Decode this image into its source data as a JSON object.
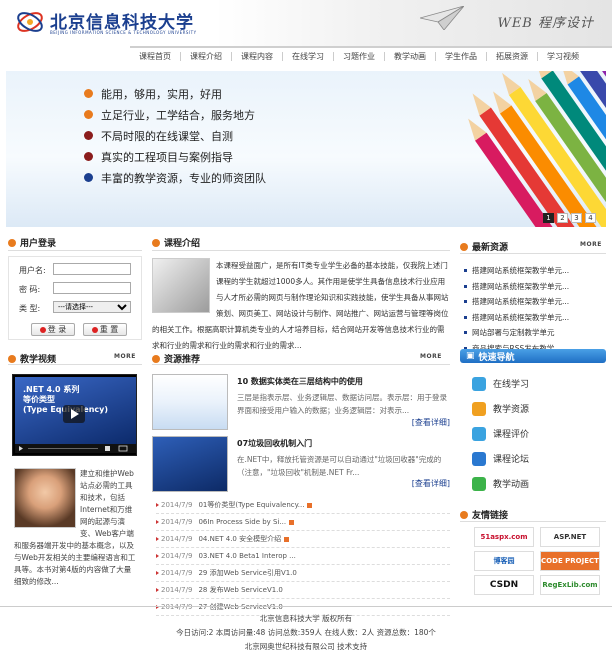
{
  "header": {
    "logo_cn": "北京信息科技大学",
    "logo_en": "BEIJING INFORMATION SCIENCE & TECHNOLOGY UNIVERSITY",
    "slogan": "WEB 程序设计"
  },
  "nav": [
    "课程首页",
    "课程介绍",
    "课程内容",
    "在线学习",
    "习题作业",
    "教学动画",
    "学生作品",
    "拓展资源",
    "学习视频"
  ],
  "banner": {
    "features": [
      {
        "text": "能用，够用，实用，好用",
        "color": "#e87b1e"
      },
      {
        "text": "立足行业，工学结合，服务地方",
        "color": "#e87b1e"
      },
      {
        "text": "不局时限的在线课堂、自测",
        "color": "#8b1d1d"
      },
      {
        "text": "真实的工程项目与案例指导",
        "color": "#8b1d1d"
      },
      {
        "text": "丰富的教学资源，专业的师资团队",
        "color": "#1b3f8f"
      }
    ],
    "pager": [
      "1",
      "2",
      "3",
      "4"
    ],
    "active_page": "1"
  },
  "login": {
    "title": "用户登录",
    "username_label": "用户名:",
    "password_label": "密  码:",
    "type_label": "类  型:",
    "type_selected": "---请选择---",
    "login_btn": "登 录",
    "reset_btn": "重 置"
  },
  "intro": {
    "title": "课程介绍",
    "text": "本课程受益面广，是所有IT类专业学生必备的基本技能，仅我院上述门课程的学生就超过1000多人。其作用是使学生具备信息技术行业应用与人才所必需的网页与制作理论知识和实践技能，使学生具备从事网站策划、网页美工、网站设计与制作、网站推广、网站运营与管理等岗位的相关工作。根据高职计算机类专业的人才培养目标，结合网站开发等信息技术行业的需求和行业的需求和行业的需求和行业的需求..."
  },
  "video": {
    "title": "教学视频",
    "more": "MORE",
    "screen_title": ".NET 4.0 系列\n等价类型\n(Type Equivalency)",
    "desc": "建立和维护Web站点必需的工具和技术，包括Internet和万维网的起源与演变、Web客户端和服务器端开发中的基本概念，以及与Web开发相关的主要编程语言和工具等。本书对第4版的内容做了大量细致的修改..."
  },
  "resources": {
    "title": "资源推荐",
    "more": "MORE",
    "items": [
      {
        "title": "10  数据实体类在三层结构中的使用",
        "desc": "三层是指表示层、业务逻辑层、数据访问层。表示层：用于登录界面和接受用户输入的数据；业务逻辑层：对表示...",
        "more": "[查看详细]"
      },
      {
        "title": "07垃圾回收机制入门",
        "desc": "在.NET中，释放托管资源是可以自动通过\"垃圾回收器\"完成的（注意，\"垃圾回收\"机制是.NET Fr...",
        "more": "[查看详细]"
      }
    ],
    "news": [
      {
        "date": "2014/7/9",
        "title": "01等价类型(Type Equivalency...",
        "new": true
      },
      {
        "date": "2014/7/9",
        "title": "06In Process Side by Si...",
        "new": true
      },
      {
        "date": "2014/7/9",
        "title": "04.NET 4.0 安全模型介绍",
        "new": true
      },
      {
        "date": "2014/7/9",
        "title": "03.NET 4.0 Beta1 Interop ...",
        "new": false
      },
      {
        "date": "2014/7/9",
        "title": "29 添加Web Service引用V1.0",
        "new": false
      },
      {
        "date": "2014/7/9",
        "title": "28 发布Web ServiceV1.0",
        "new": false
      },
      {
        "date": "2014/7/9",
        "title": "27 创建Web ServiceV1.0",
        "new": false
      }
    ]
  },
  "latest": {
    "title": "最新资源",
    "more": "MORE",
    "items": [
      "搭建网站系统框架教学单元...",
      "搭建网站系统框架教学单元...",
      "搭建网站系统框架教学单元...",
      "搭建网站系统框架教学单元...",
      "网站部署与定制教学单元",
      "商品搜索与RSS发布教学..."
    ]
  },
  "quick_nav": {
    "title": "快速导航",
    "items": [
      {
        "label": "在线学习",
        "color": "#3aa3e0"
      },
      {
        "label": "教学资源",
        "color": "#f0a020"
      },
      {
        "label": "课程评价",
        "color": "#3aa3e0"
      },
      {
        "label": "课程论坛",
        "color": "#2a78d0"
      },
      {
        "label": "教学动画",
        "color": "#3cb34a"
      }
    ]
  },
  "friend_links": {
    "title": "友情链接",
    "items": [
      {
        "label": "51aspx.com",
        "color": "#c8102e"
      },
      {
        "label": "ASP.NET",
        "color": "#333333"
      },
      {
        "label": "博客园",
        "color": "#1e63b8"
      },
      {
        "label": "CODE PROJECT",
        "color": "#e8702a"
      },
      {
        "label": "CSDN",
        "color": "#111111"
      },
      {
        "label": "RegExLib.com",
        "color": "#2e8b2e"
      }
    ]
  },
  "footer": {
    "line1": "北京信息科技大学        版权所有",
    "line2": "今日访问:2  本周访问量:48  访问总数:359人  在线人数：2人  资源总数：180个",
    "line3": "北京网奥世纪科技有限公司        技术支持"
  },
  "colors": {
    "brand": "#1b3f8f",
    "accent": "#e87b1e",
    "quick_nav_bg": "#1f6fc4"
  }
}
